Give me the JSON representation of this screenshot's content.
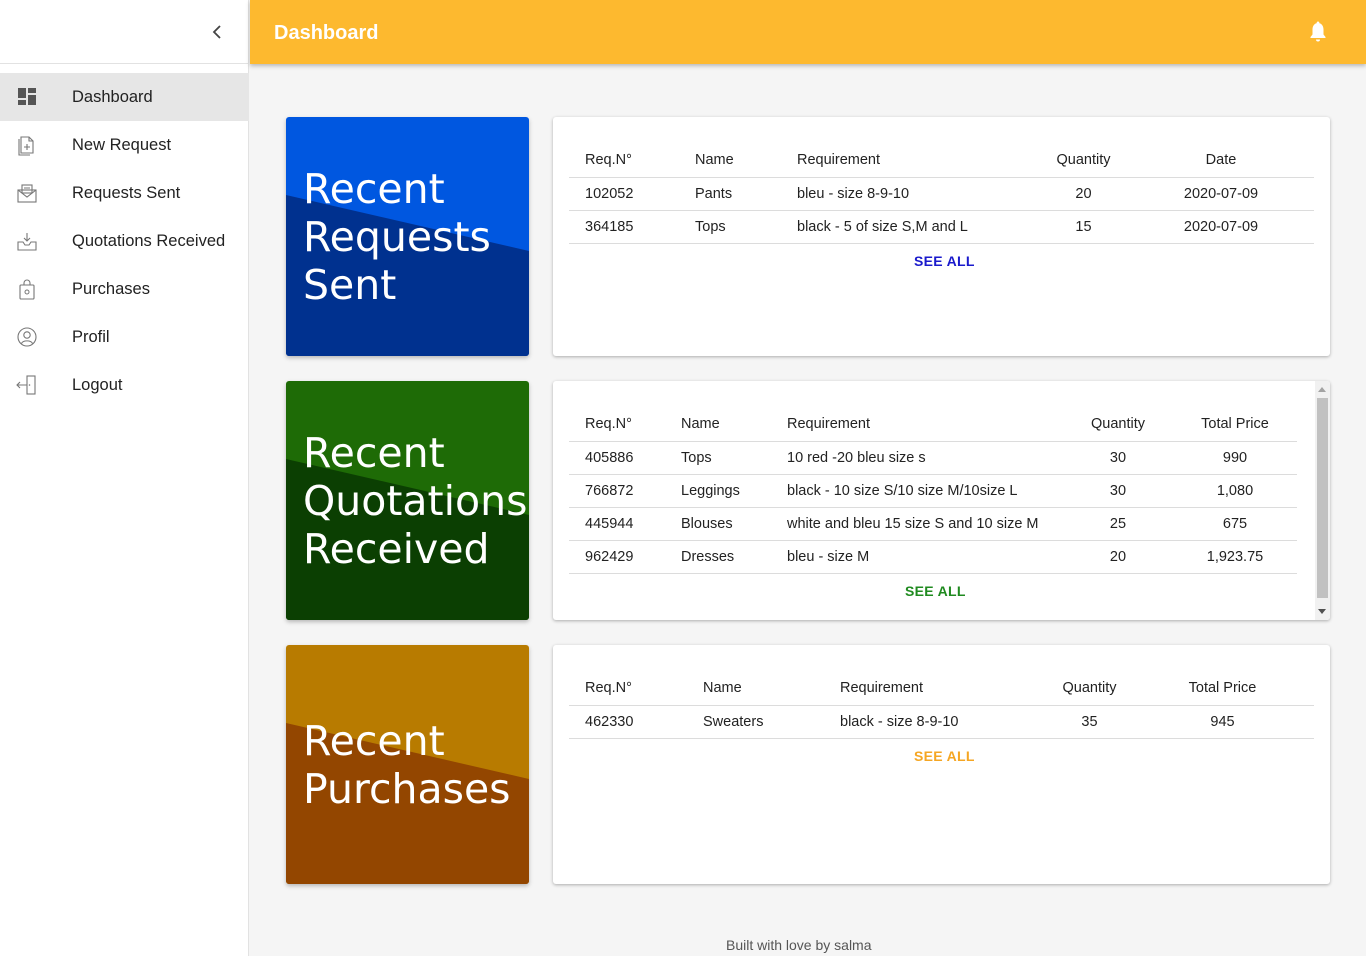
{
  "header": {
    "title": "Dashboard"
  },
  "sidebar": {
    "items": [
      {
        "label": "Dashboard",
        "icon": "dashboard-icon",
        "active": true
      },
      {
        "label": "New Request",
        "icon": "new-document-icon"
      },
      {
        "label": "Requests Sent",
        "icon": "envelope-sent-icon"
      },
      {
        "label": "Quotations Received",
        "icon": "inbox-icon"
      },
      {
        "label": "Purchases",
        "icon": "shopping-bag-icon"
      },
      {
        "label": "Profil",
        "icon": "user-circle-icon"
      },
      {
        "label": "Logout",
        "icon": "logout-icon"
      }
    ]
  },
  "sections": {
    "requests": {
      "banner_lines": [
        "Recent",
        "Requests",
        "Sent"
      ],
      "colors": {
        "light": "#0057e0",
        "dark": "#00318f"
      },
      "columns": [
        "Req.N°",
        "Name",
        "Requirement",
        "Quantity",
        "Date"
      ],
      "rows": [
        [
          "102052",
          "Pants",
          "bleu - size 8-9-10",
          "20",
          "2020-07-09"
        ],
        [
          "364185",
          "Tops",
          "black - 5 of size S,M and L",
          "15",
          "2020-07-09"
        ]
      ],
      "see_all": "SEE ALL",
      "see_all_color": "#1a1acc"
    },
    "quotations": {
      "banner_lines": [
        "Recent",
        "Quotations",
        "Received"
      ],
      "colors": {
        "light": "#1e6b06",
        "dark": "#0b3f02"
      },
      "columns": [
        "Req.N°",
        "Name",
        "Requirement",
        "Quantity",
        "Total Price"
      ],
      "rows": [
        [
          "405886",
          "Tops",
          "10 red -20 bleu size s",
          "30",
          "990"
        ],
        [
          "766872",
          "Leggings",
          "black - 10 size S/10 size M/10size L",
          "30",
          "1,080"
        ],
        [
          "445944",
          "Blouses",
          "white and bleu 15 size S and 10 size M",
          "25",
          "675"
        ],
        [
          "962429",
          "Dresses",
          "bleu - size M",
          "20",
          "1,923.75"
        ]
      ],
      "see_all": "SEE ALL",
      "see_all_color": "#1f8a1f"
    },
    "purchases": {
      "banner_lines": [
        "Recent",
        "Purchases"
      ],
      "colors": {
        "light": "#b87b00",
        "dark": "#934600"
      },
      "columns": [
        "Req.N°",
        "Name",
        "Requirement",
        "Quantity",
        "Total Price"
      ],
      "rows": [
        [
          "462330",
          "Sweaters",
          "black - size 8-9-10",
          "35",
          "945"
        ]
      ],
      "see_all": "SEE ALL",
      "see_all_color": "#f5a623"
    }
  },
  "footer": {
    "text": "Built with love by salma"
  },
  "theme": {
    "topbar": "#fdb92f",
    "active_item": "#e6e6e6"
  }
}
